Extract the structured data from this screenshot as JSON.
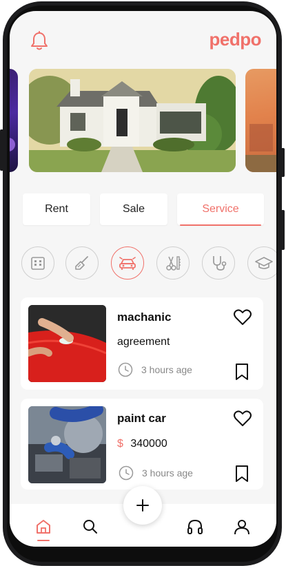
{
  "app": {
    "brand": "pedpo"
  },
  "header": {
    "notification_icon": "bell-icon"
  },
  "tabs": [
    {
      "label": "Rent",
      "active": false
    },
    {
      "label": "Sale",
      "active": false
    },
    {
      "label": "Service",
      "active": true
    }
  ],
  "categories": [
    {
      "icon": "building-icon",
      "active": false
    },
    {
      "icon": "cleaning-broom-icon",
      "active": false
    },
    {
      "icon": "car-icon",
      "active": true
    },
    {
      "icon": "barber-scissors-icon",
      "active": false
    },
    {
      "icon": "stethoscope-icon",
      "active": false
    },
    {
      "icon": "graduation-cap-icon",
      "active": false
    }
  ],
  "listings": [
    {
      "title": "machanic",
      "subtitle": "agreement",
      "time": "3 hours age"
    },
    {
      "title": "paint car",
      "price_symbol": "$",
      "price": "340000",
      "time": "3 hours age"
    }
  ],
  "bottom_nav": [
    {
      "icon": "home-icon",
      "active": true
    },
    {
      "icon": "search-icon",
      "active": false
    },
    {
      "icon": "add-icon",
      "active": false
    },
    {
      "icon": "headphones-icon",
      "active": false
    },
    {
      "icon": "user-icon",
      "active": false
    }
  ],
  "colors": {
    "accent": "#f0716a",
    "background": "#f6f6f6",
    "card": "#ffffff",
    "muted": "#888888"
  }
}
